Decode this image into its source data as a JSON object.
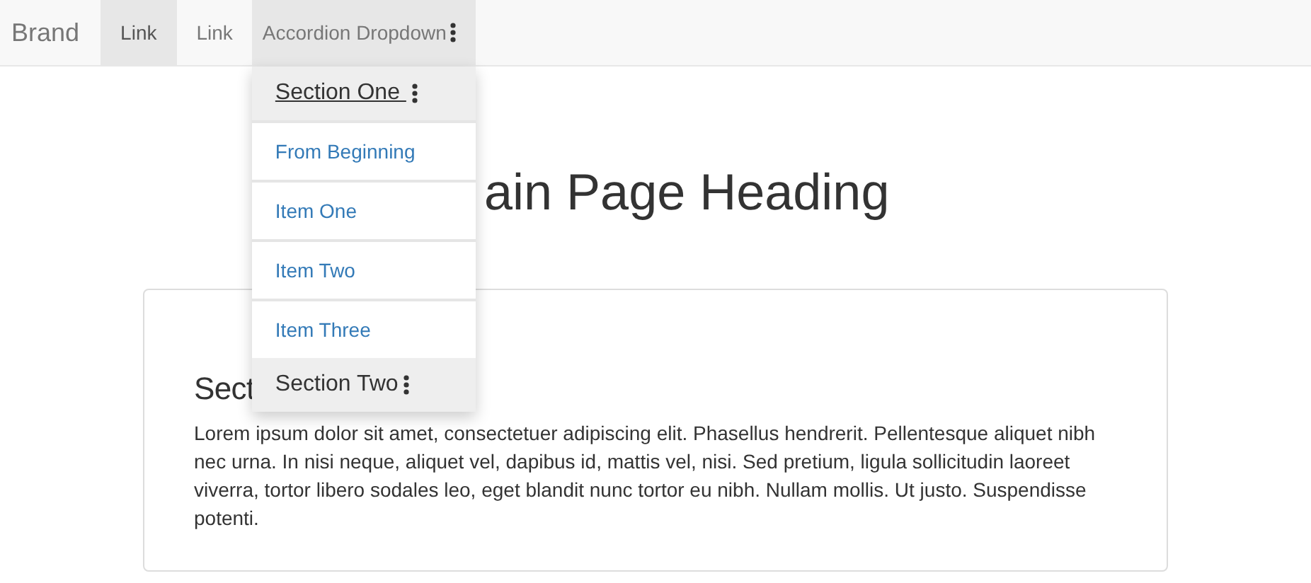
{
  "navbar": {
    "brand": "Brand",
    "items": [
      {
        "kind": "link",
        "label": "Link",
        "selected": true
      },
      {
        "kind": "link",
        "label": "Link",
        "selected": false
      },
      {
        "kind": "dropdown",
        "label": "Accordion Dropdown",
        "selected": false,
        "expanded": true,
        "sections": [
          {
            "title": "Section One",
            "hovered": true,
            "expanded": true,
            "items": [
              "From Beginning",
              "Item One",
              "Item Two",
              "Item Three"
            ]
          },
          {
            "title": "Section Two",
            "hovered": false,
            "expanded": false
          }
        ]
      }
    ]
  },
  "heading": "ain Page Heading",
  "card": {
    "title": "Sect",
    "body": "Lorem ipsum dolor sit amet, consectetuer adipiscing elit. Phasellus hendrerit. Pellentesque aliquet nibh nec urna. In nisi neque, aliquet vel, dapibus id, mattis vel, nisi. Sed pretium, ligula sollicitudin laoreet viverra, tortor libero sodales leo, eget blandit nunc tortor eu nibh. Nullam mollis. Ut justo. Suspendisse potenti."
  }
}
